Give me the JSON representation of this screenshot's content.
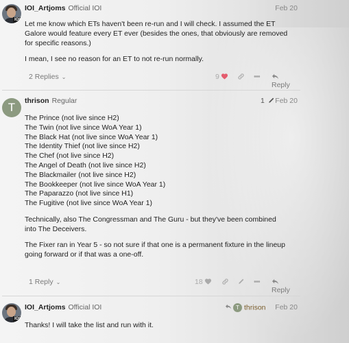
{
  "posts": [
    {
      "username": "IOI_Artjoms",
      "user_title": "Official IOI",
      "avatar_badge": "IOI",
      "date": "Feb 20",
      "paragraphs": [
        "Let me know which ETs haven't been re-run and I will check. I assumed the ET Galore would feature every ET ever (besides the ones, that obviously are removed for specific reasons.)",
        "I mean, I see no reason for an ET to not re-run normally."
      ],
      "replies_label": "2 Replies",
      "like_count": "9",
      "reply_label": "Reply"
    },
    {
      "username": "thrison",
      "user_title": "Regular",
      "avatar_letter": "T",
      "edit_count": "1",
      "date": "Feb 20",
      "list": [
        "The Prince (not live since H2)",
        "The Twin (not live since WoA Year 1)",
        "The Black Hat (not live since WoA Year 1)",
        "The Identity Thief (not live since H2)",
        "The Chef (not live since H2)",
        "The Angel of Death (not live since H2)",
        "The Blackmailer (not live since H2)",
        "The Bookkeeper (not live since WoA Year 1)",
        "The Paparazzo (not live since H1)",
        "The Fugitive (not live since WoA Year 1)"
      ],
      "paragraphs": [
        "Technically, also The Congressman and The Guru - but they've been combined into The Deceivers.",
        "The Fixer ran in Year 5 - so not sure if that one is a permanent fixture in the lineup going forward or if that was a one-off."
      ],
      "replies_label": "1 Reply",
      "like_count": "18",
      "reply_label": "Reply"
    },
    {
      "username": "IOI_Artjoms",
      "user_title": "Official IOI",
      "avatar_badge": "IOI",
      "reply_to_letter": "T",
      "reply_to": "thrison",
      "date": "Feb 20",
      "paragraphs": [
        "Thanks! I will take the list and run with it."
      ]
    }
  ],
  "icons": {
    "heart_color": "#e45c6e",
    "muted_color": "#aaaaaa"
  }
}
